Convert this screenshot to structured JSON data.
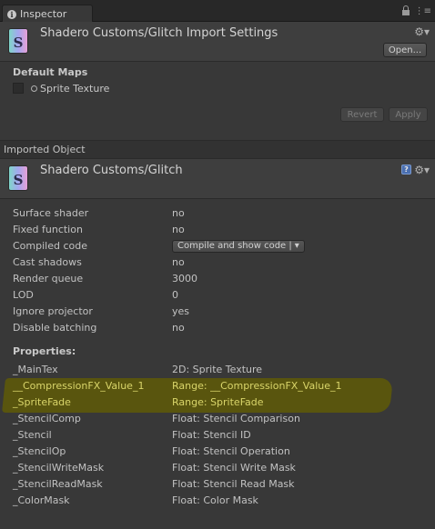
{
  "tab": {
    "label": "Inspector"
  },
  "header": {
    "title": "Shadero Customs/Glitch Import Settings",
    "open_button": "Open..."
  },
  "default_maps": {
    "title": "Default Maps",
    "slot_label": "Sprite Texture",
    "revert_button": "Revert",
    "apply_button": "Apply"
  },
  "imported": {
    "label": "Imported Object"
  },
  "shader": {
    "title": "Shadero Customs/Glitch"
  },
  "settings": [
    {
      "label": "Surface shader",
      "value": "no"
    },
    {
      "label": "Fixed function",
      "value": "no"
    },
    {
      "label": "Compiled code",
      "value": "Compile and show code |",
      "dropdown": true
    },
    {
      "label": "Cast shadows",
      "value": "no"
    },
    {
      "label": "Render queue",
      "value": "3000"
    },
    {
      "label": "LOD",
      "value": "0"
    },
    {
      "label": "Ignore projector",
      "value": "yes"
    },
    {
      "label": "Disable batching",
      "value": "no"
    }
  ],
  "properties_title": "Properties:",
  "properties": [
    {
      "label": "_MainTex",
      "value": "2D: Sprite Texture"
    },
    {
      "label": "__CompressionFX_Value_1",
      "value": "Range: __CompressionFX_Value_1",
      "highlight": true
    },
    {
      "label": "_SpriteFade",
      "value": "Range: SpriteFade",
      "highlight": true
    },
    {
      "label": "_StencilComp",
      "value": "Float: Stencil Comparison"
    },
    {
      "label": "_Stencil",
      "value": "Float: Stencil ID"
    },
    {
      "label": "_StencilOp",
      "value": "Float: Stencil Operation"
    },
    {
      "label": "_StencilWriteMask",
      "value": "Float: Stencil Write Mask"
    },
    {
      "label": "_StencilReadMask",
      "value": "Float: Stencil Read Mask"
    },
    {
      "label": "_ColorMask",
      "value": "Float: Color Mask"
    }
  ],
  "colors": {
    "background": "#383838",
    "header": "#3e3e3e",
    "highlight": "#5b560c",
    "highlight_text": "#d9d56a"
  }
}
